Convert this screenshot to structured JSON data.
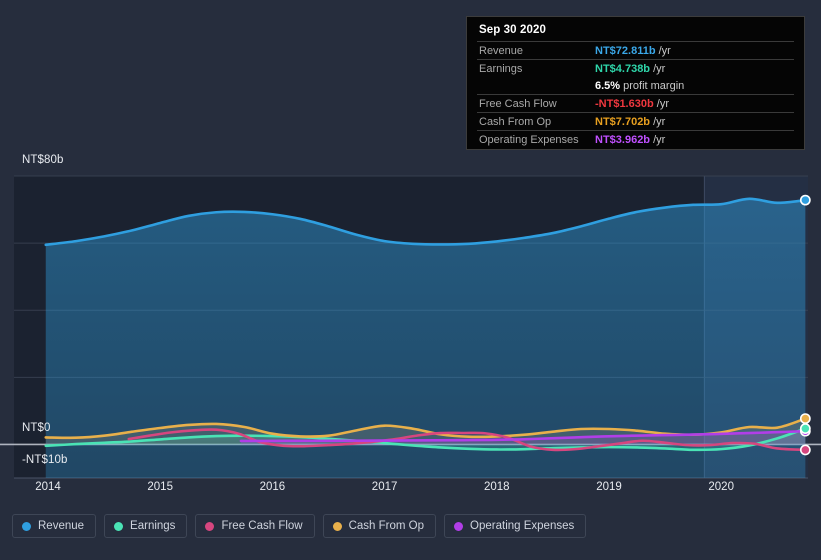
{
  "chart_data": {
    "type": "area",
    "title": "",
    "xlabel": "",
    "ylabel": "",
    "currency_prefix": "NT$",
    "unit_suffix": "b",
    "grid": true,
    "legend_position": "bottom",
    "xlim": [
      2013.75,
      2020.82
    ],
    "ylim": [
      -10,
      80
    ],
    "y_ticks": [
      80,
      60,
      40,
      20,
      0,
      -10
    ],
    "y_tick_labels": [
      "NT$80b",
      "",
      "",
      "",
      "NT$0",
      "-NT$10b"
    ],
    "x_ticks": [
      2014,
      2015,
      2016,
      2017,
      2018,
      2019,
      2020
    ],
    "x_tick_labels": [
      "2014",
      "2015",
      "2016",
      "2017",
      "2018",
      "2019",
      "2020"
    ],
    "forecast_divider_x": 2019.85,
    "series": [
      {
        "name": "Revenue",
        "color": "#2f9fe0",
        "fill": true,
        "x": [
          2013.98,
          2014.25,
          2014.5,
          2014.75,
          2015.0,
          2015.25,
          2015.5,
          2015.75,
          2016.0,
          2016.25,
          2016.5,
          2016.75,
          2017.0,
          2017.25,
          2017.5,
          2017.75,
          2018.0,
          2018.25,
          2018.5,
          2018.75,
          2019.0,
          2019.25,
          2019.5,
          2019.75,
          2020.0,
          2020.25,
          2020.5,
          2020.75
        ],
        "values": [
          59.5,
          60.6,
          62.0,
          63.8,
          66.0,
          68.1,
          69.2,
          69.3,
          68.6,
          67.2,
          65.0,
          62.5,
          60.6,
          59.8,
          59.6,
          59.8,
          60.5,
          61.6,
          63.0,
          65.0,
          67.3,
          69.3,
          70.6,
          71.4,
          71.6,
          73.2,
          72.0,
          72.811
        ]
      },
      {
        "name": "Earnings",
        "color": "#4ae3b5",
        "fill": true,
        "x": [
          2013.98,
          2014.25,
          2014.5,
          2014.75,
          2015.0,
          2015.25,
          2015.5,
          2015.75,
          2016.0,
          2016.25,
          2016.5,
          2016.75,
          2017.0,
          2017.25,
          2017.5,
          2017.75,
          2018.0,
          2018.25,
          2018.5,
          2018.75,
          2019.0,
          2019.25,
          2019.5,
          2019.75,
          2020.0,
          2020.25,
          2020.5,
          2020.75
        ],
        "values": [
          -0.4,
          0.1,
          0.5,
          0.9,
          1.5,
          2.1,
          2.5,
          2.6,
          2.5,
          2.2,
          1.7,
          1.1,
          0.4,
          -0.3,
          -0.9,
          -1.3,
          -1.5,
          -1.4,
          -1.1,
          -0.9,
          -0.8,
          -0.9,
          -1.2,
          -1.6,
          -1.4,
          -0.3,
          1.8,
          4.738
        ]
      },
      {
        "name": "Free Cash Flow",
        "color": "#d6467f",
        "fill": false,
        "x": [
          2014.72,
          2014.9,
          2015.1,
          2015.3,
          2015.5,
          2015.7,
          2015.9,
          2016.1,
          2016.3,
          2016.5,
          2016.7,
          2016.9,
          2017.1,
          2017.3,
          2017.5,
          2017.7,
          2017.9,
          2018.1,
          2018.3,
          2018.5,
          2018.7,
          2018.9,
          2019.1,
          2019.3,
          2019.5,
          2019.7,
          2019.9,
          2020.1,
          2020.3,
          2020.5,
          2020.75
        ],
        "values": [
          1.6,
          2.6,
          3.6,
          4.2,
          4.4,
          3.2,
          0.6,
          -0.4,
          -0.5,
          -0.2,
          0.2,
          0.8,
          1.6,
          2.7,
          3.4,
          3.4,
          3.3,
          2.0,
          -0.6,
          -1.6,
          -1.4,
          -0.6,
          0.3,
          1.1,
          0.5,
          -0.2,
          -0.2,
          0.4,
          0.2,
          -1.2,
          -1.63
        ]
      },
      {
        "name": "Cash From Op",
        "color": "#e8b04b",
        "fill": false,
        "x": [
          2013.98,
          2014.25,
          2014.5,
          2014.75,
          2015.0,
          2015.25,
          2015.5,
          2015.75,
          2016.0,
          2016.25,
          2016.5,
          2016.75,
          2017.0,
          2017.25,
          2017.5,
          2017.75,
          2018.0,
          2018.25,
          2018.5,
          2018.75,
          2019.0,
          2019.25,
          2019.5,
          2019.75,
          2020.0,
          2020.25,
          2020.5,
          2020.75
        ],
        "values": [
          2.1,
          2.0,
          2.6,
          3.8,
          4.9,
          5.8,
          6.1,
          5.2,
          3.2,
          2.4,
          2.6,
          4.2,
          5.6,
          4.7,
          3.0,
          2.3,
          2.4,
          2.9,
          3.8,
          4.6,
          4.6,
          4.1,
          3.2,
          2.9,
          3.6,
          5.2,
          5.0,
          7.702
        ]
      },
      {
        "name": "Operating Expenses",
        "color": "#b13ee8",
        "fill": false,
        "x": [
          2015.72,
          2015.95,
          2016.2,
          2016.45,
          2016.7,
          2016.95,
          2017.2,
          2017.45,
          2017.7,
          2017.95,
          2018.2,
          2018.45,
          2018.7,
          2018.95,
          2019.2,
          2019.45,
          2019.7,
          2019.95,
          2020.2,
          2020.45,
          2020.75
        ],
        "values": [
          1.05,
          1.06,
          1.08,
          1.1,
          1.12,
          1.15,
          1.18,
          1.22,
          1.28,
          1.35,
          1.5,
          1.8,
          2.1,
          2.4,
          2.6,
          2.75,
          2.9,
          3.1,
          3.35,
          3.6,
          3.962
        ]
      }
    ]
  },
  "tooltip": {
    "date": "Sep 30 2020",
    "rows": [
      {
        "key": "Revenue",
        "value": "NT$72.811b",
        "unit": "/yr",
        "color": "#3aa7e8"
      },
      {
        "key": "Earnings",
        "value": "NT$4.738b",
        "unit": "/yr",
        "color": "#2fd7ab"
      },
      {
        "key": "",
        "value": "6.5%",
        "unit": "profit margin",
        "color": "#ffffff",
        "margin_row": true
      },
      {
        "key": "Free Cash Flow",
        "value": "-NT$1.630b",
        "unit": "/yr",
        "color": "#f0383f"
      },
      {
        "key": "Cash From Op",
        "value": "NT$7.702b",
        "unit": "/yr",
        "color": "#e8a020"
      },
      {
        "key": "Operating Expenses",
        "value": "NT$3.962b",
        "unit": "/yr",
        "color": "#c050ff"
      }
    ]
  },
  "legend": {
    "items": [
      {
        "label": "Revenue",
        "color": "#2f9fe0"
      },
      {
        "label": "Earnings",
        "color": "#4ae3b5"
      },
      {
        "label": "Free Cash Flow",
        "color": "#d6467f"
      },
      {
        "label": "Cash From Op",
        "color": "#e8b04b"
      },
      {
        "label": "Operating Expenses",
        "color": "#b13ee8"
      }
    ]
  },
  "theme": {
    "background": "#262d3d",
    "plot_background": "#1b2230",
    "grid_color": "#3b4354",
    "zero_line_color": "#c8cdd6",
    "axis_text": "#e8ebf0"
  }
}
